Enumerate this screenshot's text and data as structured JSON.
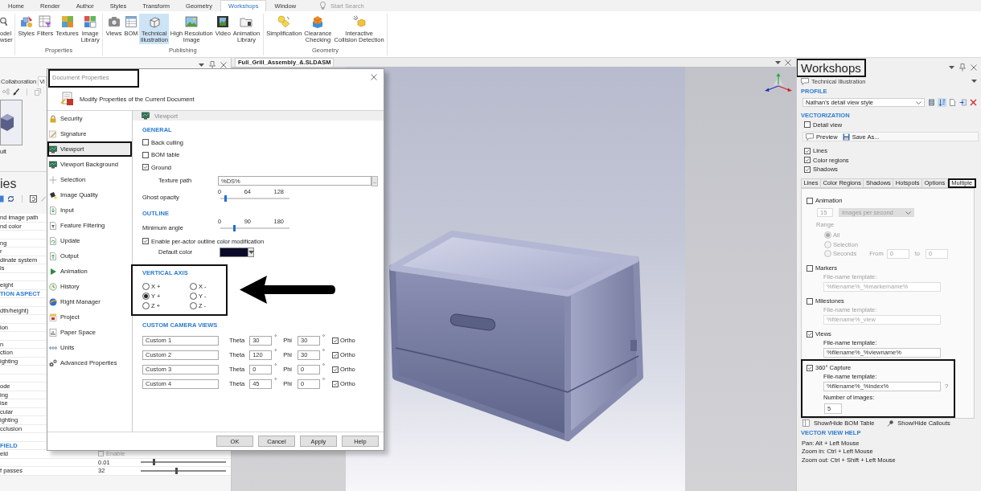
{
  "ribbon_tabs": [
    {
      "label": "Home",
      "selected": false
    },
    {
      "label": "Render",
      "selected": false
    },
    {
      "label": "Author",
      "selected": false
    },
    {
      "label": "Styles",
      "selected": false
    },
    {
      "label": "Transform",
      "selected": false
    },
    {
      "label": "Geometry",
      "selected": false
    },
    {
      "label": "Workshops",
      "selected": true
    },
    {
      "label": "Window",
      "selected": false
    }
  ],
  "search": {
    "placeholder": "Start Search"
  },
  "ribbon_groups": [
    {
      "buttons": [
        {
          "label": "odel\nwser",
          "selected": false
        }
      ]
    },
    {
      "label": "Properties",
      "buttons": [
        {
          "label": "Styles",
          "selected": false
        },
        {
          "label": "Filters",
          "selected": false
        },
        {
          "label": "Textures",
          "selected": false
        },
        {
          "label": "Image\nLibrary",
          "selected": false
        }
      ]
    },
    {
      "label": "Publishing",
      "buttons": [
        {
          "label": "Views",
          "selected": false
        },
        {
          "label": "BOM",
          "selected": false
        },
        {
          "label": "Technical\nIllustration",
          "selected": true
        },
        {
          "label": "High Resolution\nImage",
          "selected": false
        },
        {
          "label": "Video",
          "selected": false
        },
        {
          "label": "Animation\nLibrary",
          "selected": false
        }
      ]
    },
    {
      "label": "Geometry",
      "buttons": [
        {
          "label": "Simplification",
          "selected": false
        },
        {
          "label": "Clearance\nChecking",
          "selected": false
        },
        {
          "label": "Interactive\nCollision Detection",
          "selected": false
        }
      ]
    }
  ],
  "left_panel": {
    "tabs": [
      {
        "label": "Collaboration",
        "selected": false
      },
      {
        "label": "Vi",
        "selected": true
      }
    ],
    "thumbnail_caption": "ult",
    "title": "ies",
    "properties": [
      {
        "kind": "row",
        "label": "nd image path"
      },
      {
        "kind": "row",
        "label": "nd color"
      },
      {
        "kind": "blank"
      },
      {
        "kind": "row",
        "label": "ng"
      },
      {
        "kind": "row",
        "label": "r"
      },
      {
        "kind": "row",
        "label": "dinate system"
      },
      {
        "kind": "row",
        "label": "is"
      },
      {
        "kind": "blank"
      },
      {
        "kind": "row",
        "label": "eight"
      },
      {
        "kind": "header",
        "label": "TION ASPECT"
      },
      {
        "kind": "blank"
      },
      {
        "kind": "row",
        "label": "dth/height)"
      },
      {
        "kind": "blank"
      },
      {
        "kind": "row",
        "label": "ion"
      },
      {
        "kind": "blank"
      },
      {
        "kind": "row",
        "label": "n"
      },
      {
        "kind": "row",
        "label": "ction"
      },
      {
        "kind": "row",
        "label": "ighting"
      },
      {
        "kind": "blank"
      },
      {
        "kind": "blank"
      },
      {
        "kind": "row",
        "label": "ode"
      },
      {
        "kind": "row",
        "label": "ing"
      },
      {
        "kind": "row",
        "label": "ise"
      },
      {
        "kind": "row",
        "label": "cular"
      },
      {
        "kind": "row",
        "label": "ighting"
      },
      {
        "kind": "row",
        "label": "cclusion"
      },
      {
        "kind": "blank"
      },
      {
        "kind": "header",
        "label": "FIELD"
      },
      {
        "kind": "check",
        "label": "eld",
        "value": "Enable",
        "checked": false,
        "disabled": true
      },
      {
        "kind": "slider",
        "value": "0.01",
        "level": 0.16
      },
      {
        "kind": "slider",
        "label": "f passes",
        "value": "32",
        "level": 0.42
      }
    ]
  },
  "dialog": {
    "title": "Document Properties",
    "title_highlighted": true,
    "header": "Modify Properties of the Current Document",
    "nav": [
      {
        "label": "Security",
        "selected": false,
        "highlighted": false
      },
      {
        "label": "Signature",
        "selected": false,
        "highlighted": false
      },
      {
        "label": "Viewport",
        "selected": true,
        "highlighted": true
      },
      {
        "label": "Viewport Background",
        "selected": false,
        "highlighted": false
      },
      {
        "label": "Selection",
        "selected": false,
        "highlighted": false
      },
      {
        "label": "Image Quality",
        "selected": false,
        "highlighted": false
      },
      {
        "label": "Input",
        "selected": false,
        "highlighted": false
      },
      {
        "label": "Feature Filtering",
        "selected": false,
        "highlighted": false
      },
      {
        "label": "Update",
        "selected": false,
        "highlighted": false
      },
      {
        "label": "Output",
        "selected": false,
        "highlighted": false
      },
      {
        "label": "Animation",
        "selected": false,
        "highlighted": false
      },
      {
        "label": "History",
        "selected": false,
        "highlighted": false
      },
      {
        "label": "Right Manager",
        "selected": false,
        "highlighted": false
      },
      {
        "label": "Project",
        "selected": false,
        "highlighted": false
      },
      {
        "label": "Paper Space",
        "selected": false,
        "highlighted": false
      },
      {
        "label": "Units",
        "selected": false,
        "highlighted": false
      },
      {
        "label": "Advanced Properties",
        "selected": false,
        "highlighted": false
      }
    ],
    "page_title": "Viewport",
    "general": {
      "heading": "GENERAL",
      "options": [
        {
          "label": "Back culling",
          "checked": false
        },
        {
          "label": "BOM table",
          "checked": false
        },
        {
          "label": "Ground",
          "checked": true
        }
      ],
      "texture_path": {
        "label": "Texture path",
        "value": "%DS%",
        "browse": ".."
      },
      "ghost_opacity": {
        "label": "Ghost opacity",
        "ticks": [
          "0",
          "64",
          "128"
        ],
        "level": 0.08
      }
    },
    "outline": {
      "heading": "OUTLINE",
      "minimum_angle": {
        "label": "Minimum angle",
        "ticks": [
          "0",
          "90",
          "180"
        ],
        "level": 0.2
      },
      "per_actor": {
        "label": "Enable per-actor outline color modification",
        "checked": true
      },
      "default_color": {
        "label": "Default color",
        "color": "#0a0a28"
      }
    },
    "vertical_axis": {
      "heading": "VERTICAL AXIS",
      "highlighted": true,
      "options": [
        {
          "label": "X +",
          "selected": false
        },
        {
          "label": "X -",
          "selected": false
        },
        {
          "label": "Y +",
          "selected": true
        },
        {
          "label": "Y -",
          "selected": false
        },
        {
          "label": "Z +",
          "selected": false
        },
        {
          "label": "Z -",
          "selected": false
        }
      ]
    },
    "camera_views": {
      "heading": "CUSTOM CAMERA VIEWS",
      "views": [
        {
          "name": "Custom 1",
          "theta_label": "Theta",
          "theta": "30",
          "theta_unit": "°",
          "phi_label": "Phi",
          "phi": "30",
          "phi_unit": "°",
          "ortho_label": "Ortho",
          "ortho": true
        },
        {
          "name": "Custom 2",
          "theta_label": "Theta",
          "theta": "120",
          "theta_unit": "°",
          "phi_label": "Phi",
          "phi": "30",
          "phi_unit": "°",
          "ortho_label": "Ortho",
          "ortho": true
        },
        {
          "name": "Custom 3",
          "theta_label": "Theta",
          "theta": "0",
          "theta_unit": "°",
          "phi_label": "Phi",
          "phi": "0",
          "phi_unit": "°",
          "ortho_label": "Ortho",
          "ortho": true
        },
        {
          "name": "Custom 4",
          "theta_label": "Theta",
          "theta": "45",
          "theta_unit": "°",
          "phi_label": "Phi",
          "phi": "0",
          "phi_unit": "°",
          "ortho_label": "Ortho",
          "ortho": true
        }
      ]
    },
    "buttons": [
      {
        "label": "OK"
      },
      {
        "label": "Cancel"
      },
      {
        "label": "Apply"
      },
      {
        "label": "Help"
      }
    ]
  },
  "document_tab": {
    "label": "Full_Grill_Assembly_&.SLDASM"
  },
  "workshops_panel": {
    "title": "Workshops",
    "title_highlighted": true,
    "workshop": "Technical Illustration",
    "profile": {
      "heading": "PROFILE",
      "value": "Nathan's detail view style",
      "tools": [
        {
          "selected": false
        },
        {
          "selected": true
        },
        {
          "selected": false
        },
        {
          "selected": false
        },
        {
          "selected": false
        }
      ]
    },
    "vectorization": {
      "heading": "VECTORIZATION",
      "detail_view": {
        "label": "Detail view",
        "checked": false
      },
      "actions": [
        {
          "label": "Preview"
        },
        {
          "label": "Save As..."
        }
      ],
      "layers": [
        {
          "label": "Lines",
          "checked": true
        },
        {
          "label": "Color regions",
          "checked": true
        },
        {
          "label": "Shadows",
          "checked": true
        }
      ]
    },
    "tabs": [
      {
        "label": "Lines",
        "selected": false,
        "highlighted": false
      },
      {
        "label": "Color Regions",
        "selected": false,
        "highlighted": false
      },
      {
        "label": "Shadows",
        "selected": false,
        "highlighted": false
      },
      {
        "label": "Hotspots",
        "selected": false,
        "highlighted": false
      },
      {
        "label": "Options",
        "selected": false,
        "highlighted": false
      },
      {
        "label": "Multiple",
        "selected": true,
        "highlighted": true
      }
    ],
    "animation": {
      "label": "Animation",
      "checked": false,
      "rate": "15",
      "rate_unit": "Images per second",
      "range_label": "Range",
      "range_options": [
        {
          "label": "All",
          "selected": true
        },
        {
          "label": "Selection",
          "selected": false
        },
        {
          "label": "Seconds",
          "selected": false,
          "from_label": "From",
          "from": "0",
          "to_label": "to",
          "to": "0"
        }
      ]
    },
    "outputs": [
      {
        "label": "Markers",
        "checked": false,
        "highlighted": false,
        "template_label": "File-name template:",
        "template": "%filename%_%markername%"
      },
      {
        "label": "Milestones",
        "checked": false,
        "highlighted": false,
        "template_label": "File-name template:",
        "template": "%filename%_view"
      },
      {
        "label": "Views",
        "checked": true,
        "highlighted": false,
        "template_label": "File-name template:",
        "template": "%filename%_%viewname%"
      },
      {
        "label": "360° Capture",
        "checked": true,
        "highlighted": true,
        "template_label": "File-name template:",
        "template": "%filename%_%index%",
        "help": "?",
        "count_label": "Number of images:",
        "count": "5"
      }
    ],
    "footer_actions": [
      {
        "label": "Show/Hide BOM Table"
      },
      {
        "label": "Show/Hide Callouts"
      }
    ],
    "help": {
      "heading": "VECTOR VIEW HELP",
      "lines": [
        "Pan: Alt + Left Mouse",
        "Zoom in: Ctrl + Left Mouse",
        "Zoom out: Ctrl + Shift + Left Mouse"
      ]
    }
  }
}
